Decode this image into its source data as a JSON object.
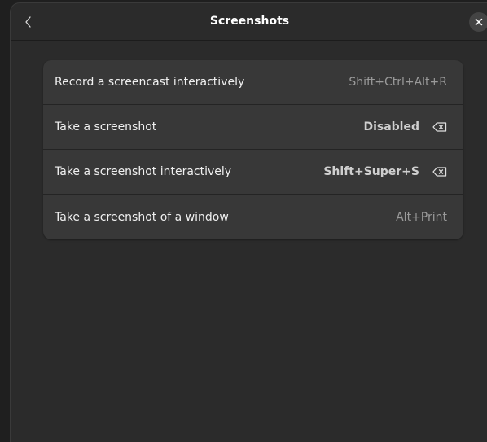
{
  "header": {
    "title": "Screenshots"
  },
  "shortcuts": [
    {
      "label": "Record a screencast interactively",
      "accel": "Shift+Ctrl+Alt+R"
    },
    {
      "label": "Take a screenshot",
      "accel": "Disabled"
    },
    {
      "label": "Take a screenshot interactively",
      "accel": "Shift+Super+S"
    },
    {
      "label": "Take a screenshot of a window",
      "accel": "Alt+Print"
    }
  ],
  "icons": {
    "back": "chevron-left-icon",
    "close": "close-icon",
    "clear": "backspace-icon"
  }
}
